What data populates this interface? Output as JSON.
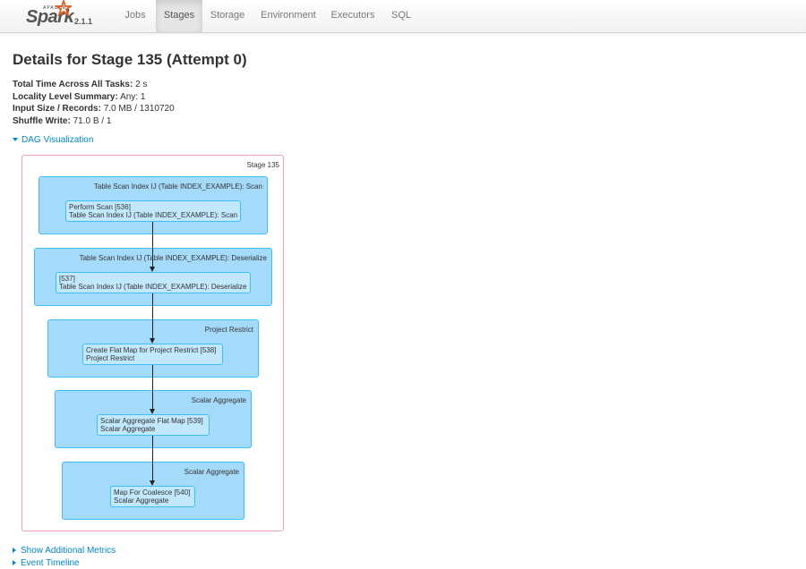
{
  "navbar": {
    "brand": {
      "apache": "APACHE",
      "name": "Spark",
      "version": "2.1.1"
    },
    "items": [
      {
        "label": "Jobs",
        "active": false
      },
      {
        "label": "Stages",
        "active": true
      },
      {
        "label": "Storage",
        "active": false
      },
      {
        "label": "Environment",
        "active": false
      },
      {
        "label": "Executors",
        "active": false
      },
      {
        "label": "SQL",
        "active": false
      }
    ]
  },
  "page": {
    "title": "Details for Stage 135 (Attempt 0)",
    "summary": [
      {
        "label": "Total Time Across All Tasks:",
        "value": "2 s"
      },
      {
        "label": "Locality Level Summary:",
        "value": "Any: 1"
      },
      {
        "label": "Input Size / Records:",
        "value": "7.0 MB / 1310720"
      },
      {
        "label": "Shuffle Write:",
        "value": "71.0 B / 1"
      }
    ],
    "dag_toggle": "DAG Visualization",
    "additional_metrics_toggle": "Show Additional Metrics",
    "event_timeline_toggle": "Event Timeline"
  },
  "dag": {
    "stage_label": "Stage 135",
    "clusters": [
      {
        "label": "Table Scan Index IJ (Table INDEX_EXAMPLE): Scan",
        "node_line1": "Perform Scan [536]",
        "node_line2": "Table Scan Index IJ (Table INDEX_EXAMPLE): Scan"
      },
      {
        "label": "Table Scan Index IJ (Table INDEX_EXAMPLE): Deserialize",
        "node_line1": "[537]",
        "node_line2": "Table Scan Index IJ (Table INDEX_EXAMPLE): Deserialize"
      },
      {
        "label": "Project Restrict",
        "node_line1": "Create Flat Map for Project Restrict [538]",
        "node_line2": "Project Restrict"
      },
      {
        "label": "Scalar Aggregate",
        "node_line1": "Scalar Aggregate Flat Map [539]",
        "node_line2": "Scalar Aggregate"
      },
      {
        "label": "Scalar Aggregate",
        "node_line1": "Map For Coalesce [540]",
        "node_line2": "Scalar Aggregate"
      }
    ]
  },
  "colors": {
    "link": "#0088cc",
    "cluster_fill": "#a4dbfb",
    "node_fill": "#c2e8fd",
    "cluster_border": "#3ec0f7",
    "stage_border": "#f3a3b4"
  }
}
